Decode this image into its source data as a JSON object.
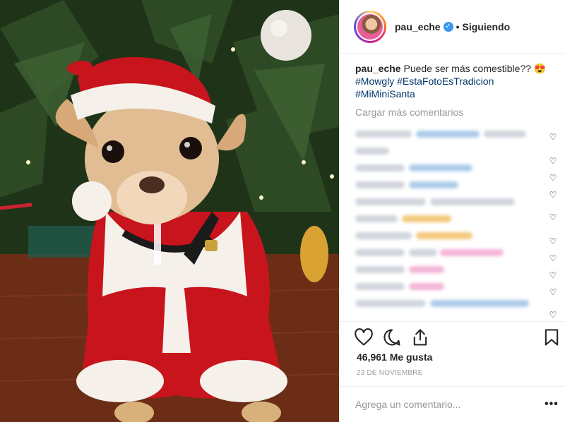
{
  "post": {
    "photo_description_icon": "chihuahua-santa-photo",
    "header": {
      "username": "pau_eche",
      "verified_icon": "verified-badge-icon",
      "separator": "•",
      "follow_status": "Siguiendo"
    },
    "caption": {
      "username": "pau_eche",
      "text": " Puede ser más comestible?? ",
      "emoji": "😍",
      "hashtags": [
        "#Mowgly",
        "#EstaFotoEsTradicion",
        "#MiMiniSanta"
      ]
    },
    "load_more_label": "Cargar más comentarios",
    "actions": {
      "like_icon": "heart-icon",
      "comment_icon": "comment-icon",
      "share_icon": "share-icon",
      "save_icon": "bookmark-icon"
    },
    "likes_count": "46,961",
    "likes_label": " Me gusta",
    "date": "23 DE NOVIEMBRE",
    "add_comment_placeholder": "Agrega un comentario...",
    "more_options": "•••"
  },
  "colors": {
    "link": "#003569",
    "muted": "#999999",
    "verified": "#3897f0"
  }
}
